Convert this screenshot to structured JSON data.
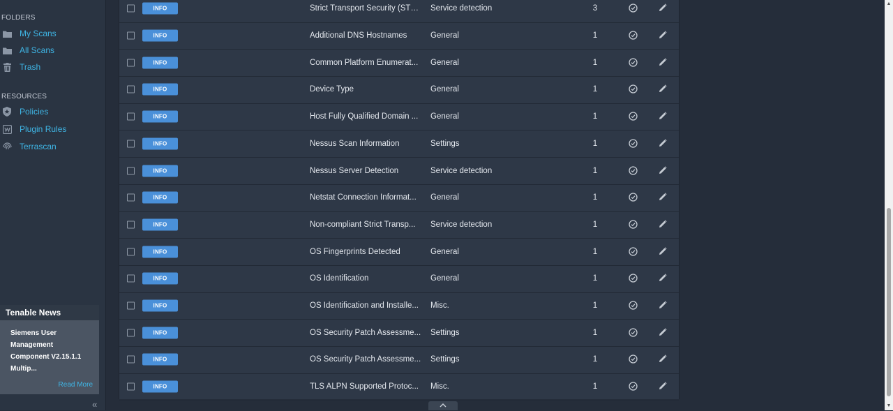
{
  "sidebar": {
    "folders_label": "FOLDERS",
    "folders": [
      {
        "label": "My Scans",
        "icon": "folder-icon"
      },
      {
        "label": "All Scans",
        "icon": "folder-icon"
      },
      {
        "label": "Trash",
        "icon": "trash-icon"
      }
    ],
    "resources_label": "RESOURCES",
    "resources": [
      {
        "label": "Policies",
        "icon": "shield-icon"
      },
      {
        "label": "Plugin Rules",
        "icon": "rules-icon"
      },
      {
        "label": "Terrascan",
        "icon": "fingerprint-icon"
      }
    ],
    "news": {
      "header": "Tenable News",
      "title": "Siemens User Management Component V2.15.1.1 Multip...",
      "read_more": "Read More"
    }
  },
  "vulnerabilities": [
    {
      "severity": "INFO",
      "name": "Strict Transport Security (STS...",
      "family": "Service detection",
      "count": "3"
    },
    {
      "severity": "INFO",
      "name": "Additional DNS Hostnames",
      "family": "General",
      "count": "1"
    },
    {
      "severity": "INFO",
      "name": "Common Platform Enumerat...",
      "family": "General",
      "count": "1"
    },
    {
      "severity": "INFO",
      "name": "Device Type",
      "family": "General",
      "count": "1"
    },
    {
      "severity": "INFO",
      "name": "Host Fully Qualified Domain ...",
      "family": "General",
      "count": "1"
    },
    {
      "severity": "INFO",
      "name": "Nessus Scan Information",
      "family": "Settings",
      "count": "1"
    },
    {
      "severity": "INFO",
      "name": "Nessus Server Detection",
      "family": "Service detection",
      "count": "1"
    },
    {
      "severity": "INFO",
      "name": "Netstat Connection Informat...",
      "family": "General",
      "count": "1"
    },
    {
      "severity": "INFO",
      "name": "Non-compliant Strict Transp...",
      "family": "Service detection",
      "count": "1"
    },
    {
      "severity": "INFO",
      "name": "OS Fingerprints Detected",
      "family": "General",
      "count": "1"
    },
    {
      "severity": "INFO",
      "name": "OS Identification",
      "family": "General",
      "count": "1"
    },
    {
      "severity": "INFO",
      "name": "OS Identification and Installe...",
      "family": "Misc.",
      "count": "1"
    },
    {
      "severity": "INFO",
      "name": "OS Security Patch Assessme...",
      "family": "Settings",
      "count": "1"
    },
    {
      "severity": "INFO",
      "name": "OS Security Patch Assessme...",
      "family": "Settings",
      "count": "1"
    },
    {
      "severity": "INFO",
      "name": "TLS ALPN Supported Protoc...",
      "family": "Misc.",
      "count": "1"
    }
  ],
  "colors": {
    "accent": "#3fb6e6",
    "info_badge": "#4a90d9",
    "background": "#252d3a"
  }
}
